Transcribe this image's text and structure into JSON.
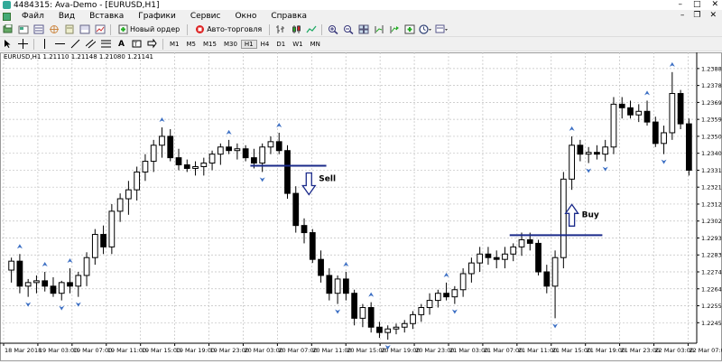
{
  "window": {
    "title": "4484315: Ava-Demo - [EURUSD,H1]",
    "controls": [
      "–",
      "□",
      "✕"
    ],
    "mdi_controls": [
      "–",
      "❐",
      "✕"
    ]
  },
  "menu": [
    "Файл",
    "Вид",
    "Вставка",
    "Графики",
    "Сервис",
    "Окно",
    "Справка"
  ],
  "toolbar": {
    "new_order": "Новый ордер",
    "auto_trading": "Авто-торговля"
  },
  "timeframes": [
    "M1",
    "M5",
    "M15",
    "M30",
    "H1",
    "H4",
    "D1",
    "W1",
    "MN"
  ],
  "chart_header": "EURUSD,H1  1.21110 1.21148 1.21080 1.21141",
  "colors": {
    "fractal": "#3c6fc4",
    "line": "#1a2a8a",
    "grid": "#c0c0c0"
  },
  "annotations": {
    "sell": "Sell",
    "buy": "Buy"
  },
  "chart_data": {
    "type": "candlestick",
    "symbol": "EURUSD",
    "timeframe": "H1",
    "y_ticks": [
      "1.23880",
      "1.23785",
      "1.23690",
      "1.23595",
      "1.23500",
      "1.23405",
      "1.23310",
      "1.23215",
      "1.23120",
      "1.23025",
      "1.22930",
      "1.22835",
      "1.22740",
      "1.22645",
      "1.22550",
      "1.22455"
    ],
    "x_ticks": [
      "18 Mar 2018",
      "19 Mar 03:00",
      "19 Mar 07:00",
      "19 Mar 11:00",
      "19 Mar 15:00",
      "19 Mar 19:00",
      "19 Mar 23:00",
      "20 Mar 03:00",
      "20 Mar 07:00",
      "20 Mar 11:00",
      "20 Mar 15:00",
      "20 Mar 19:00",
      "20 Mar 23:00",
      "21 Mar 03:00",
      "21 Mar 07:00",
      "21 Mar 11:00",
      "21 Mar 15:00",
      "21 Mar 19:00",
      "21 Mar 23:00",
      "22 Mar 03:00",
      "22 Mar 07:00"
    ],
    "candles": [
      {
        "o": 1.2275,
        "h": 1.2282,
        "l": 1.2268,
        "c": 1.228
      },
      {
        "o": 1.228,
        "h": 1.2284,
        "l": 1.2262,
        "c": 1.2266
      },
      {
        "o": 1.2266,
        "h": 1.227,
        "l": 1.226,
        "c": 1.2268
      },
      {
        "o": 1.2268,
        "h": 1.2272,
        "l": 1.2262,
        "c": 1.2269
      },
      {
        "o": 1.2269,
        "h": 1.2274,
        "l": 1.2263,
        "c": 1.2266
      },
      {
        "o": 1.2266,
        "h": 1.2271,
        "l": 1.226,
        "c": 1.2262
      },
      {
        "o": 1.2262,
        "h": 1.2269,
        "l": 1.2258,
        "c": 1.2268
      },
      {
        "o": 1.2268,
        "h": 1.2276,
        "l": 1.2262,
        "c": 1.2266
      },
      {
        "o": 1.2266,
        "h": 1.2274,
        "l": 1.226,
        "c": 1.2272
      },
      {
        "o": 1.2272,
        "h": 1.2285,
        "l": 1.2266,
        "c": 1.2282
      },
      {
        "o": 1.2282,
        "h": 1.2298,
        "l": 1.2278,
        "c": 1.2295
      },
      {
        "o": 1.2295,
        "h": 1.23,
        "l": 1.2284,
        "c": 1.2288
      },
      {
        "o": 1.2288,
        "h": 1.2312,
        "l": 1.2284,
        "c": 1.2308
      },
      {
        "o": 1.2308,
        "h": 1.2318,
        "l": 1.2302,
        "c": 1.2315
      },
      {
        "o": 1.2315,
        "h": 1.2325,
        "l": 1.2306,
        "c": 1.232
      },
      {
        "o": 1.232,
        "h": 1.2333,
        "l": 1.2314,
        "c": 1.233
      },
      {
        "o": 1.233,
        "h": 1.234,
        "l": 1.2325,
        "c": 1.2336
      },
      {
        "o": 1.2336,
        "h": 1.2348,
        "l": 1.233,
        "c": 1.2345
      },
      {
        "o": 1.2345,
        "h": 1.2355,
        "l": 1.2338,
        "c": 1.235
      },
      {
        "o": 1.235,
        "h": 1.2354,
        "l": 1.2336,
        "c": 1.2338
      },
      {
        "o": 1.2338,
        "h": 1.2343,
        "l": 1.2331,
        "c": 1.2334
      },
      {
        "o": 1.2334,
        "h": 1.2337,
        "l": 1.233,
        "c": 1.2332
      },
      {
        "o": 1.2332,
        "h": 1.2336,
        "l": 1.2328,
        "c": 1.2333
      },
      {
        "o": 1.2333,
        "h": 1.2338,
        "l": 1.2328,
        "c": 1.2335
      },
      {
        "o": 1.2335,
        "h": 1.2342,
        "l": 1.2331,
        "c": 1.234
      },
      {
        "o": 1.234,
        "h": 1.2346,
        "l": 1.2334,
        "c": 1.2344
      },
      {
        "o": 1.2344,
        "h": 1.2348,
        "l": 1.234,
        "c": 1.2342
      },
      {
        "o": 1.2342,
        "h": 1.2346,
        "l": 1.2337,
        "c": 1.2343
      },
      {
        "o": 1.2343,
        "h": 1.2345,
        "l": 1.2336,
        "c": 1.2338
      },
      {
        "o": 1.2338,
        "h": 1.2343,
        "l": 1.2332,
        "c": 1.2335
      },
      {
        "o": 1.2335,
        "h": 1.2346,
        "l": 1.233,
        "c": 1.2344
      },
      {
        "o": 1.2344,
        "h": 1.235,
        "l": 1.234,
        "c": 1.2347
      },
      {
        "o": 1.2347,
        "h": 1.2352,
        "l": 1.234,
        "c": 1.2342
      },
      {
        "o": 1.2342,
        "h": 1.2345,
        "l": 1.2315,
        "c": 1.2318
      },
      {
        "o": 1.2318,
        "h": 1.2322,
        "l": 1.2296,
        "c": 1.23
      },
      {
        "o": 1.23,
        "h": 1.2304,
        "l": 1.229,
        "c": 1.2296
      },
      {
        "o": 1.2296,
        "h": 1.2298,
        "l": 1.2279,
        "c": 1.2281
      },
      {
        "o": 1.2281,
        "h": 1.2286,
        "l": 1.2268,
        "c": 1.2272
      },
      {
        "o": 1.2272,
        "h": 1.2276,
        "l": 1.2258,
        "c": 1.2262
      },
      {
        "o": 1.2262,
        "h": 1.2272,
        "l": 1.2256,
        "c": 1.227
      },
      {
        "o": 1.227,
        "h": 1.2274,
        "l": 1.2258,
        "c": 1.2262
      },
      {
        "o": 1.2262,
        "h": 1.2264,
        "l": 1.2244,
        "c": 1.2248
      },
      {
        "o": 1.2248,
        "h": 1.2256,
        "l": 1.2243,
        "c": 1.2254
      },
      {
        "o": 1.2254,
        "h": 1.2257,
        "l": 1.224,
        "c": 1.2243
      },
      {
        "o": 1.2243,
        "h": 1.2246,
        "l": 1.2237,
        "c": 1.224
      },
      {
        "o": 1.224,
        "h": 1.2244,
        "l": 1.2236,
        "c": 1.2242
      },
      {
        "o": 1.2242,
        "h": 1.2245,
        "l": 1.2239,
        "c": 1.2243
      },
      {
        "o": 1.2243,
        "h": 1.2247,
        "l": 1.224,
        "c": 1.2245
      },
      {
        "o": 1.2245,
        "h": 1.2252,
        "l": 1.2242,
        "c": 1.225
      },
      {
        "o": 1.225,
        "h": 1.2256,
        "l": 1.2246,
        "c": 1.2254
      },
      {
        "o": 1.2254,
        "h": 1.2262,
        "l": 1.225,
        "c": 1.2258
      },
      {
        "o": 1.2258,
        "h": 1.2264,
        "l": 1.2254,
        "c": 1.2262
      },
      {
        "o": 1.2262,
        "h": 1.2268,
        "l": 1.2258,
        "c": 1.226
      },
      {
        "o": 1.226,
        "h": 1.2266,
        "l": 1.2256,
        "c": 1.2264
      },
      {
        "o": 1.2264,
        "h": 1.2276,
        "l": 1.226,
        "c": 1.2273
      },
      {
        "o": 1.2273,
        "h": 1.2282,
        "l": 1.2268,
        "c": 1.2279
      },
      {
        "o": 1.2279,
        "h": 1.2288,
        "l": 1.2274,
        "c": 1.2284
      },
      {
        "o": 1.2284,
        "h": 1.2288,
        "l": 1.2278,
        "c": 1.2282
      },
      {
        "o": 1.2282,
        "h": 1.2286,
        "l": 1.2276,
        "c": 1.2281
      },
      {
        "o": 1.2281,
        "h": 1.2288,
        "l": 1.2276,
        "c": 1.2284
      },
      {
        "o": 1.2284,
        "h": 1.229,
        "l": 1.228,
        "c": 1.2288
      },
      {
        "o": 1.2288,
        "h": 1.2296,
        "l": 1.2283,
        "c": 1.2292
      },
      {
        "o": 1.2292,
        "h": 1.2296,
        "l": 1.2286,
        "c": 1.229
      },
      {
        "o": 1.229,
        "h": 1.2292,
        "l": 1.2272,
        "c": 1.2274
      },
      {
        "o": 1.2274,
        "h": 1.2278,
        "l": 1.2262,
        "c": 1.2266
      },
      {
        "o": 1.2266,
        "h": 1.2286,
        "l": 1.2248,
        "c": 1.2282
      },
      {
        "o": 1.2282,
        "h": 1.233,
        "l": 1.2276,
        "c": 1.2326
      },
      {
        "o": 1.2326,
        "h": 1.235,
        "l": 1.232,
        "c": 1.2345
      },
      {
        "o": 1.2345,
        "h": 1.2348,
        "l": 1.2336,
        "c": 1.234
      },
      {
        "o": 1.234,
        "h": 1.2344,
        "l": 1.2335,
        "c": 1.2341
      },
      {
        "o": 1.2341,
        "h": 1.2345,
        "l": 1.2337,
        "c": 1.234
      },
      {
        "o": 1.234,
        "h": 1.2348,
        "l": 1.2336,
        "c": 1.2344
      },
      {
        "o": 1.2344,
        "h": 1.2372,
        "l": 1.234,
        "c": 1.2368
      },
      {
        "o": 1.2368,
        "h": 1.2372,
        "l": 1.236,
        "c": 1.2366
      },
      {
        "o": 1.2366,
        "h": 1.237,
        "l": 1.236,
        "c": 1.2362
      },
      {
        "o": 1.2362,
        "h": 1.2368,
        "l": 1.2358,
        "c": 1.2364
      },
      {
        "o": 1.2364,
        "h": 1.237,
        "l": 1.2356,
        "c": 1.2358
      },
      {
        "o": 1.2358,
        "h": 1.2361,
        "l": 1.2344,
        "c": 1.2346
      },
      {
        "o": 1.2346,
        "h": 1.2356,
        "l": 1.234,
        "c": 1.2352
      },
      {
        "o": 1.2352,
        "h": 1.2386,
        "l": 1.2348,
        "c": 1.2374
      },
      {
        "o": 1.2374,
        "h": 1.2376,
        "l": 1.2354,
        "c": 1.2357
      },
      {
        "o": 1.2357,
        "h": 1.236,
        "l": 1.2328,
        "c": 1.2331
      }
    ],
    "sell_level": 1.23335,
    "buy_level": 1.22946
  }
}
